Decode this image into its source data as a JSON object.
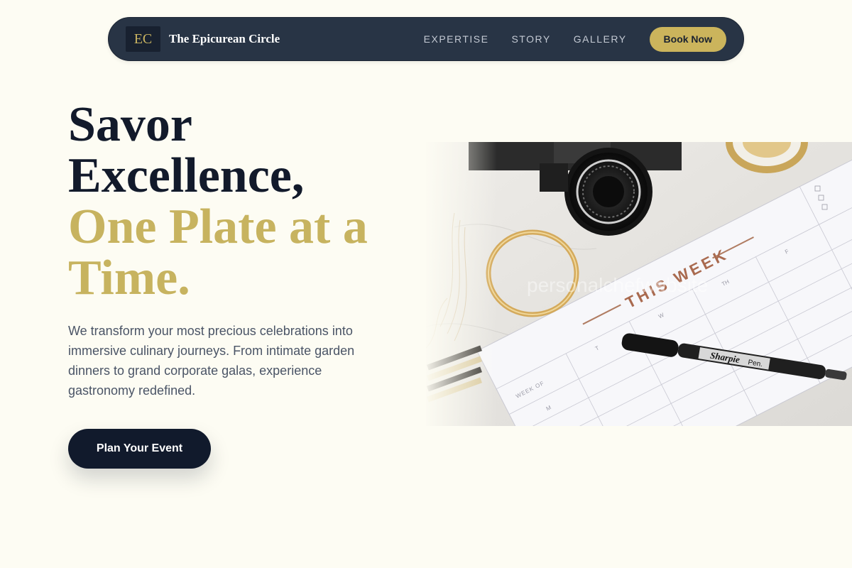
{
  "nav": {
    "logo_mark": "EC",
    "brand": "The Epicurean Circle",
    "links": [
      "EXPERTISE",
      "STORY",
      "GALLERY"
    ],
    "cta": "Book Now"
  },
  "hero": {
    "title_line1": "Savor",
    "title_line2": "Excellence,",
    "title_accent_line1": "One Plate at a",
    "title_accent_line2": "Time.",
    "description": "We transform your most precious celebrations into immersive culinary journeys. From intimate garden dinners to grand corporate galas, experience gastronomy redefined.",
    "cta": "Plan Your Event"
  },
  "image": {
    "watermark": "personalchefwebsite",
    "planner_title": "THIS WEEK",
    "pen_brand": "Sharpie",
    "pen_label": "Pen.",
    "day_labels": [
      "M",
      "T",
      "W",
      "TH",
      "F"
    ],
    "week_of": "WEEK OF"
  },
  "colors": {
    "background": "#fdfcf3",
    "navy": "#111a2c",
    "nav_bg": "#283445",
    "gold": "#c9b35e"
  }
}
